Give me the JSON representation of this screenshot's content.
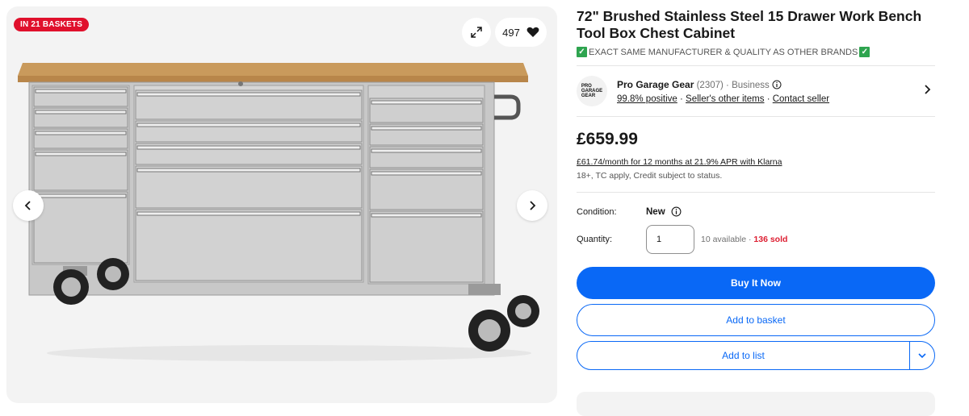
{
  "gallery": {
    "badge": "IN 21 BASKETS",
    "watch_count": "497"
  },
  "listing": {
    "title": "72\" Brushed Stainless Steel 15 Drawer Work Bench Tool Box Chest Cabinet",
    "subtitle": "EXACT SAME MANUFACTURER & QUALITY AS OTHER BRANDS",
    "price": "£659.99",
    "klarna": "£61.74/month for 12 months at 21.9% APR with Klarna",
    "terms": "18+, TC apply, Credit subject to status."
  },
  "seller": {
    "logo_text_1": "PRO",
    "logo_text_2": "GARAGE",
    "logo_text_3": "GEAR",
    "name": "Pro Garage Gear",
    "feedback_count": "(2307)",
    "type": "· Business",
    "positive": "99.8% positive",
    "other_items": "Seller's other items",
    "contact": "Contact seller",
    "dot": "·"
  },
  "condition": {
    "label": "Condition:",
    "value": "New"
  },
  "quantity": {
    "label": "Quantity:",
    "value": "1",
    "available": "10 available ·",
    "sold": "136 sold"
  },
  "actions": {
    "buy_now": "Buy It Now",
    "add_to_basket": "Add to basket",
    "add_to_list": "Add to list"
  },
  "colors": {
    "accent": "#0968f6",
    "badge": "#e0102c",
    "sold": "#dd1e31",
    "check": "#2ea44f"
  },
  "icons": [
    "expand-icon",
    "heart-icon",
    "chevron-left-icon",
    "chevron-right-icon",
    "info-icon",
    "chevron-down-icon",
    "check-icon"
  ]
}
